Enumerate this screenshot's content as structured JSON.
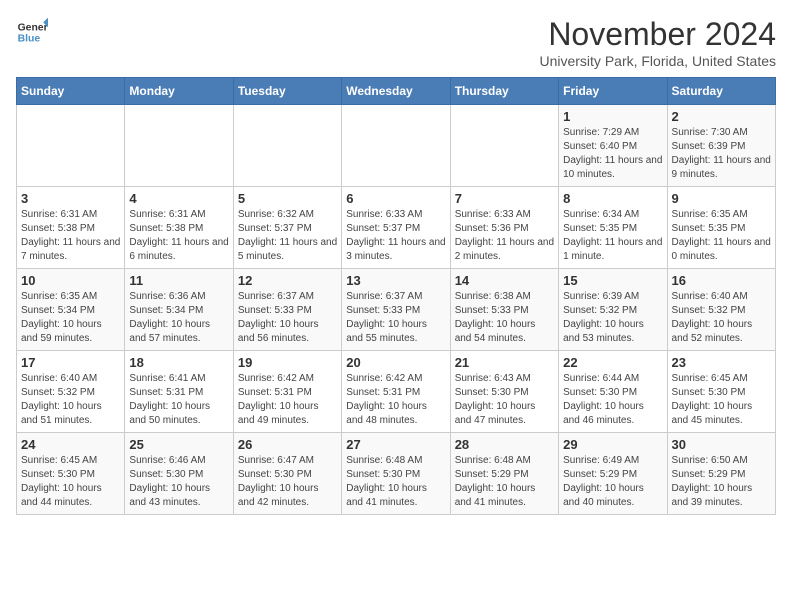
{
  "logo": {
    "line1": "General",
    "line2": "Blue"
  },
  "title": "November 2024",
  "location": "University Park, Florida, United States",
  "calendar": {
    "headers": [
      "Sunday",
      "Monday",
      "Tuesday",
      "Wednesday",
      "Thursday",
      "Friday",
      "Saturday"
    ],
    "weeks": [
      [
        {
          "day": "",
          "info": ""
        },
        {
          "day": "",
          "info": ""
        },
        {
          "day": "",
          "info": ""
        },
        {
          "day": "",
          "info": ""
        },
        {
          "day": "",
          "info": ""
        },
        {
          "day": "1",
          "info": "Sunrise: 7:29 AM\nSunset: 6:40 PM\nDaylight: 11 hours and 10 minutes."
        },
        {
          "day": "2",
          "info": "Sunrise: 7:30 AM\nSunset: 6:39 PM\nDaylight: 11 hours and 9 minutes."
        }
      ],
      [
        {
          "day": "3",
          "info": "Sunrise: 6:31 AM\nSunset: 5:38 PM\nDaylight: 11 hours and 7 minutes."
        },
        {
          "day": "4",
          "info": "Sunrise: 6:31 AM\nSunset: 5:38 PM\nDaylight: 11 hours and 6 minutes."
        },
        {
          "day": "5",
          "info": "Sunrise: 6:32 AM\nSunset: 5:37 PM\nDaylight: 11 hours and 5 minutes."
        },
        {
          "day": "6",
          "info": "Sunrise: 6:33 AM\nSunset: 5:37 PM\nDaylight: 11 hours and 3 minutes."
        },
        {
          "day": "7",
          "info": "Sunrise: 6:33 AM\nSunset: 5:36 PM\nDaylight: 11 hours and 2 minutes."
        },
        {
          "day": "8",
          "info": "Sunrise: 6:34 AM\nSunset: 5:35 PM\nDaylight: 11 hours and 1 minute."
        },
        {
          "day": "9",
          "info": "Sunrise: 6:35 AM\nSunset: 5:35 PM\nDaylight: 11 hours and 0 minutes."
        }
      ],
      [
        {
          "day": "10",
          "info": "Sunrise: 6:35 AM\nSunset: 5:34 PM\nDaylight: 10 hours and 59 minutes."
        },
        {
          "day": "11",
          "info": "Sunrise: 6:36 AM\nSunset: 5:34 PM\nDaylight: 10 hours and 57 minutes."
        },
        {
          "day": "12",
          "info": "Sunrise: 6:37 AM\nSunset: 5:33 PM\nDaylight: 10 hours and 56 minutes."
        },
        {
          "day": "13",
          "info": "Sunrise: 6:37 AM\nSunset: 5:33 PM\nDaylight: 10 hours and 55 minutes."
        },
        {
          "day": "14",
          "info": "Sunrise: 6:38 AM\nSunset: 5:33 PM\nDaylight: 10 hours and 54 minutes."
        },
        {
          "day": "15",
          "info": "Sunrise: 6:39 AM\nSunset: 5:32 PM\nDaylight: 10 hours and 53 minutes."
        },
        {
          "day": "16",
          "info": "Sunrise: 6:40 AM\nSunset: 5:32 PM\nDaylight: 10 hours and 52 minutes."
        }
      ],
      [
        {
          "day": "17",
          "info": "Sunrise: 6:40 AM\nSunset: 5:32 PM\nDaylight: 10 hours and 51 minutes."
        },
        {
          "day": "18",
          "info": "Sunrise: 6:41 AM\nSunset: 5:31 PM\nDaylight: 10 hours and 50 minutes."
        },
        {
          "day": "19",
          "info": "Sunrise: 6:42 AM\nSunset: 5:31 PM\nDaylight: 10 hours and 49 minutes."
        },
        {
          "day": "20",
          "info": "Sunrise: 6:42 AM\nSunset: 5:31 PM\nDaylight: 10 hours and 48 minutes."
        },
        {
          "day": "21",
          "info": "Sunrise: 6:43 AM\nSunset: 5:30 PM\nDaylight: 10 hours and 47 minutes."
        },
        {
          "day": "22",
          "info": "Sunrise: 6:44 AM\nSunset: 5:30 PM\nDaylight: 10 hours and 46 minutes."
        },
        {
          "day": "23",
          "info": "Sunrise: 6:45 AM\nSunset: 5:30 PM\nDaylight: 10 hours and 45 minutes."
        }
      ],
      [
        {
          "day": "24",
          "info": "Sunrise: 6:45 AM\nSunset: 5:30 PM\nDaylight: 10 hours and 44 minutes."
        },
        {
          "day": "25",
          "info": "Sunrise: 6:46 AM\nSunset: 5:30 PM\nDaylight: 10 hours and 43 minutes."
        },
        {
          "day": "26",
          "info": "Sunrise: 6:47 AM\nSunset: 5:30 PM\nDaylight: 10 hours and 42 minutes."
        },
        {
          "day": "27",
          "info": "Sunrise: 6:48 AM\nSunset: 5:30 PM\nDaylight: 10 hours and 41 minutes."
        },
        {
          "day": "28",
          "info": "Sunrise: 6:48 AM\nSunset: 5:29 PM\nDaylight: 10 hours and 41 minutes."
        },
        {
          "day": "29",
          "info": "Sunrise: 6:49 AM\nSunset: 5:29 PM\nDaylight: 10 hours and 40 minutes."
        },
        {
          "day": "30",
          "info": "Sunrise: 6:50 AM\nSunset: 5:29 PM\nDaylight: 10 hours and 39 minutes."
        }
      ]
    ]
  }
}
